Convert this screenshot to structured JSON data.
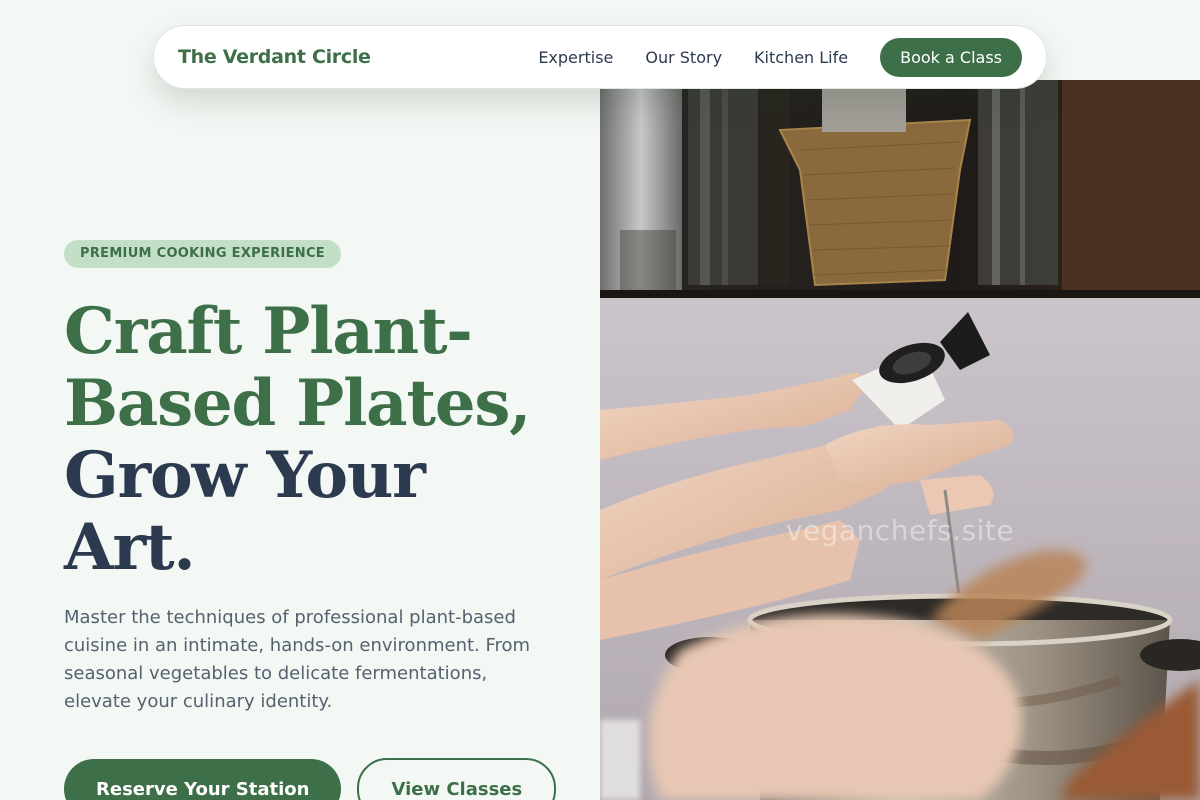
{
  "nav": {
    "brand": "The Verdant Circle",
    "links": [
      "Expertise",
      "Our Story",
      "Kitchen Life"
    ],
    "cta": "Book a Class"
  },
  "hero": {
    "badge": "PREMIUM COOKING EXPERIENCE",
    "headline_green_1": "Craft Plant-",
    "headline_green_2": "Based Plates,",
    "headline_navy_1": "Grow Your",
    "headline_navy_2": "Art.",
    "description": "Master the techniques of professional plant-based cuisine in an intimate, hands-on environment. From seasonal vegetables to delicate fermentations, elevate your culinary identity.",
    "primary_button": "Reserve Your Station",
    "secondary_button": "View Classes"
  },
  "image": {
    "subject": "hands-cooking-pot-photo",
    "watermark": "veganchefs.site"
  },
  "colors": {
    "accent_green": "#3d7048",
    "navy": "#2c3a4f",
    "badge_bg": "#c3e0c7",
    "page_bg": "#f3f8f4"
  }
}
